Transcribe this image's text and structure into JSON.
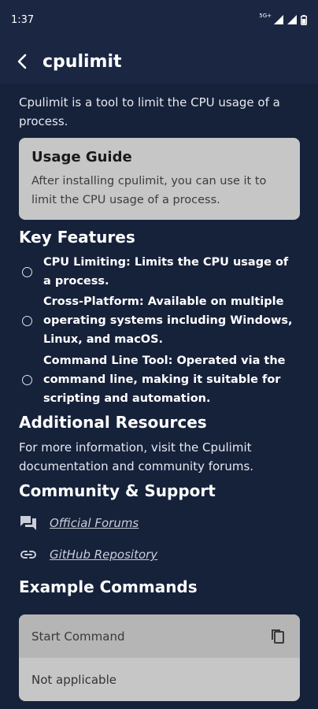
{
  "status_bar": {
    "time": "1:37",
    "network": "5G+"
  },
  "app_bar": {
    "title": "cpulimit"
  },
  "intro": "Cpulimit is a tool to limit the CPU usage of a process.",
  "usage_guide": {
    "title": "Usage Guide",
    "body": "After installing cpulimit, you can use it to limit the CPU usage of a process."
  },
  "key_features": {
    "heading": "Key Features",
    "items": [
      {
        "text": "CPU Limiting: Limits the CPU usage of a process."
      },
      {
        "text": "Cross-Platform: Available on multiple operating systems including Windows, Linux, and macOS."
      },
      {
        "text": "Command Line Tool: Operated via the command line, making it suitable for scripting and automation."
      }
    ]
  },
  "additional_resources": {
    "heading": "Additional Resources",
    "text": "For more information, visit the Cpulimit documentation and community forums."
  },
  "community": {
    "heading": "Community & Support",
    "links": [
      {
        "label": "Official Forums",
        "icon": "forum-icon"
      },
      {
        "label": "GitHub Repository",
        "icon": "link-icon"
      }
    ]
  },
  "example_commands": {
    "heading": "Example Commands",
    "label": "Start Command",
    "value": "Not applicable"
  },
  "colors": {
    "background": "#16213a",
    "app_bar": "#1b2742",
    "card": "#c6c6c6",
    "card_header": "#b5b5b5"
  }
}
